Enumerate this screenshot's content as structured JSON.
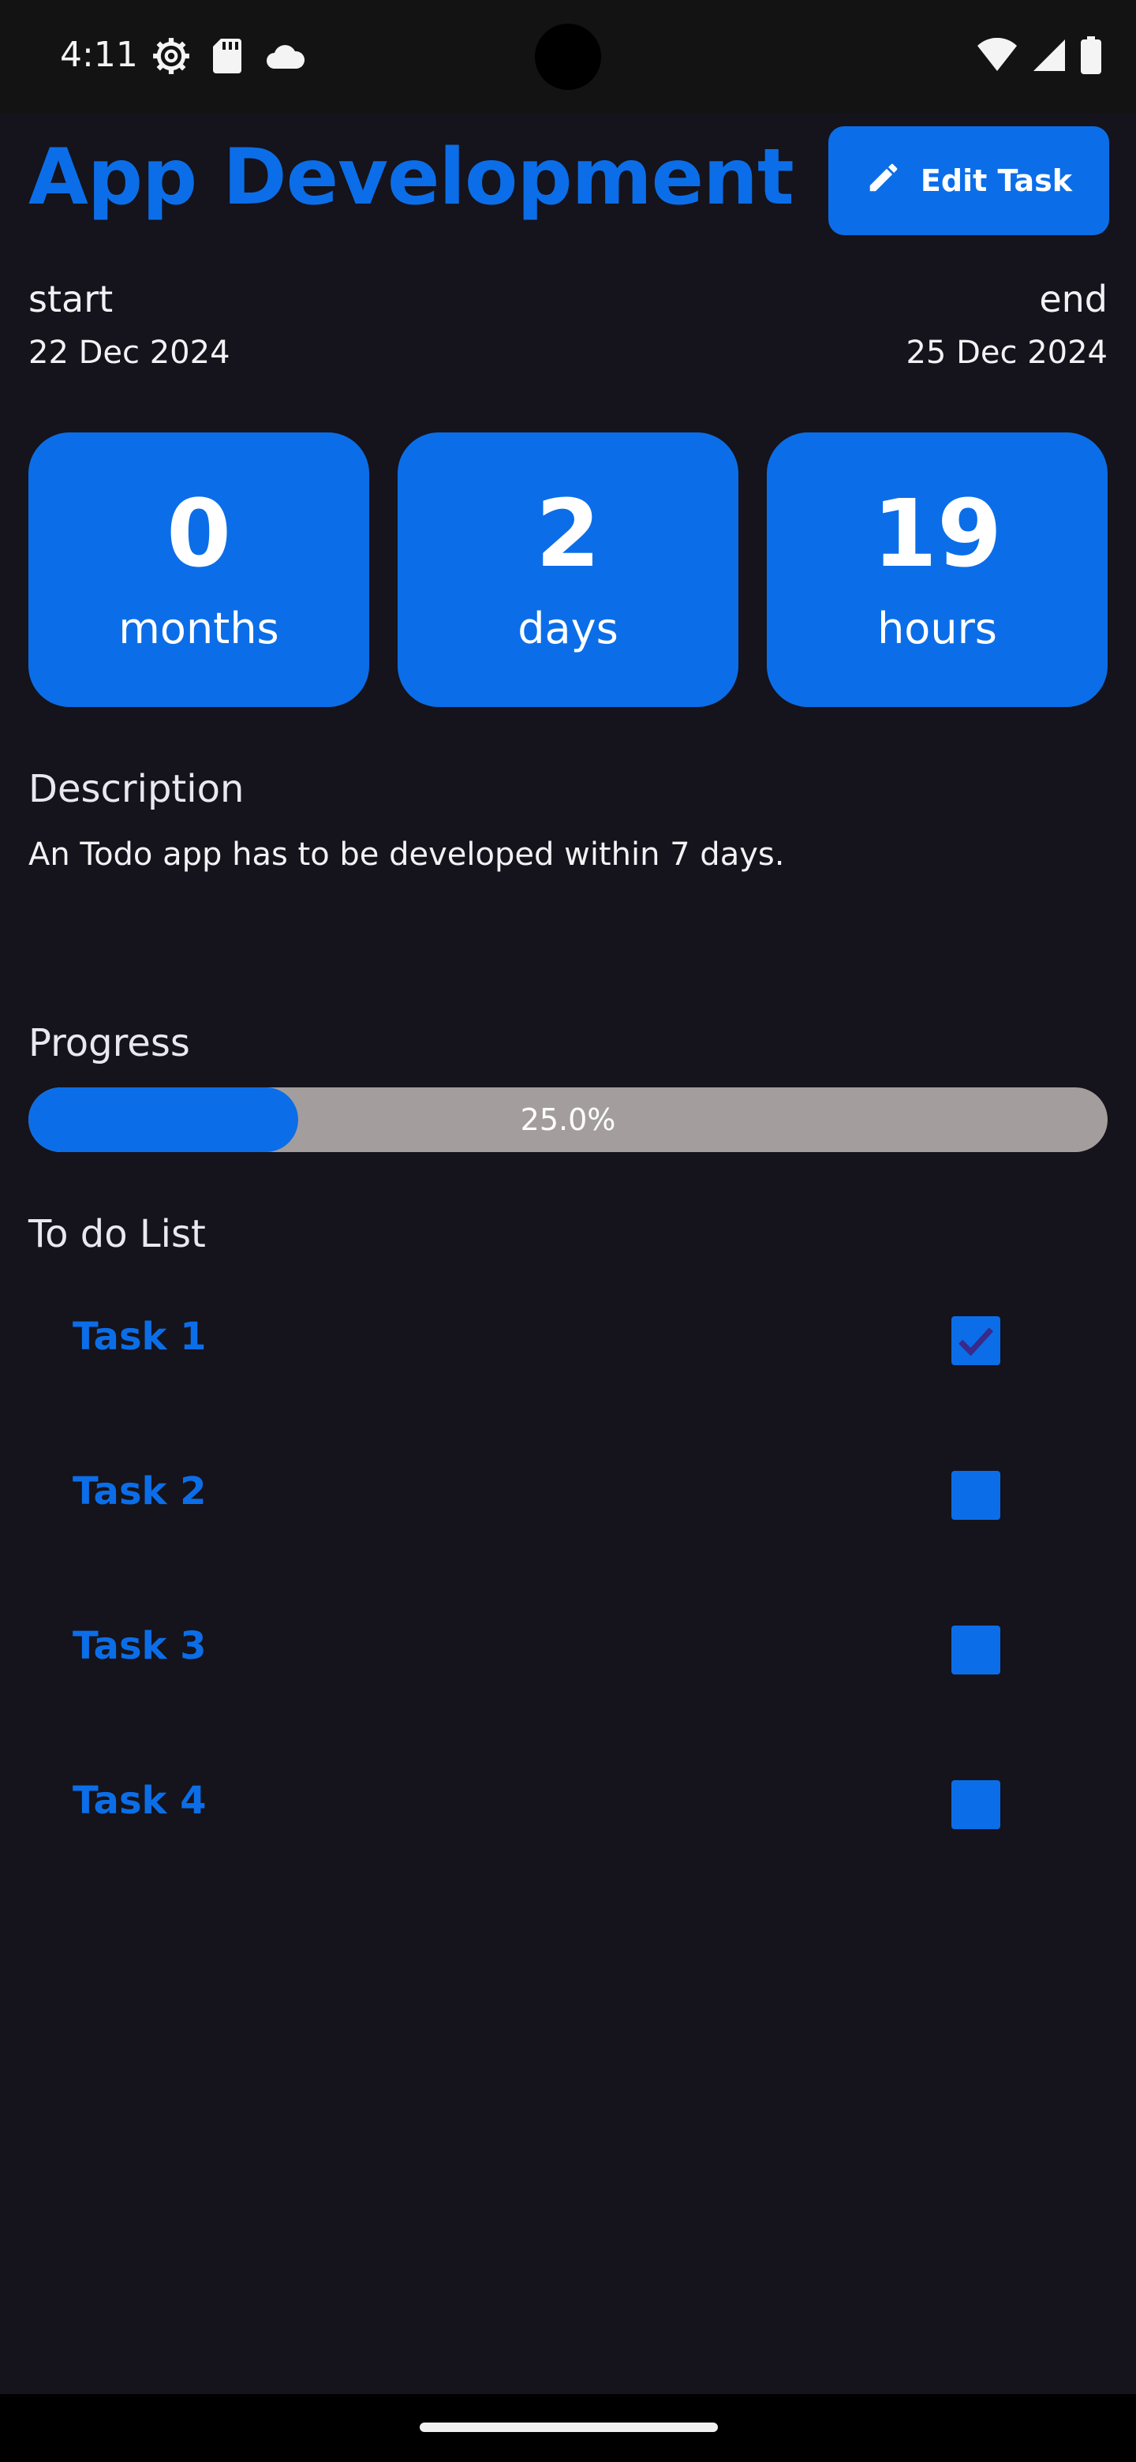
{
  "status_bar": {
    "time": "4:11",
    "left_icons": [
      "settings-icon",
      "sd-card-icon",
      "cloud-icon"
    ],
    "right_icons": [
      "wifi-icon",
      "signal-icon",
      "battery-icon"
    ]
  },
  "header": {
    "title": "App Development",
    "edit_button_label": "Edit Task"
  },
  "dates": {
    "start_label": "start",
    "start_value": "22 Dec 2024",
    "end_label": "end",
    "end_value": "25 Dec 2024"
  },
  "countdown": [
    {
      "value": "0",
      "unit": "months"
    },
    {
      "value": "2",
      "unit": "days"
    },
    {
      "value": "19",
      "unit": "hours"
    }
  ],
  "description": {
    "heading": "Description",
    "text": "An Todo app has to be developed within 7 days."
  },
  "progress": {
    "heading": "Progress",
    "label": "25.0%",
    "value": 0.25
  },
  "todo": {
    "heading": "To do List",
    "items": [
      {
        "label": "Task 1",
        "checked": true
      },
      {
        "label": "Task 2",
        "checked": false
      },
      {
        "label": "Task 3",
        "checked": false
      },
      {
        "label": "Task 4",
        "checked": false
      }
    ]
  },
  "colors": {
    "accent": "#0b6ee8",
    "background": "#15131b",
    "progress_track": "#a39e9d",
    "check_mark": "#3a2a8a"
  }
}
